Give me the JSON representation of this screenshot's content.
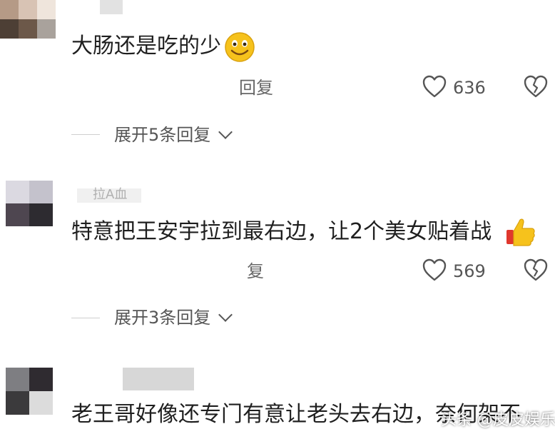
{
  "comments": [
    {
      "text": "大肠还是吃的少",
      "emoji": "smile-emoji",
      "reply_label": "回复",
      "likes": "636",
      "expand_label": "展开5条回复"
    },
    {
      "username_partial": "拉A血",
      "text": "特意把王安宇拉到最右边，让2个美女贴着战",
      "emoji": "thumbs-up-emoji",
      "reply_label": "复",
      "likes": "569",
      "expand_label": "展开3条回复"
    },
    {
      "text": "老王哥好像还专门有意让老头去右边，奈何架不"
    }
  ],
  "watermark": "头条 @皮皮娱乐",
  "colors": {
    "text": "#1f1f1f",
    "muted": "#666666",
    "emoji_yellow": "#f6c21c"
  }
}
